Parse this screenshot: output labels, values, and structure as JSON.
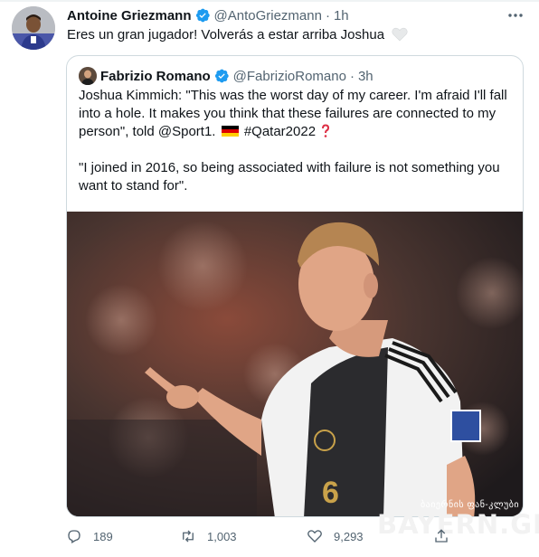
{
  "tweet": {
    "author_name": "Antoine Griezmann",
    "author_handle": "@AntoGriezmann",
    "separator": "·",
    "time": "1h",
    "text": "Eres un gran jugador! Volverás a estar arriba Joshua",
    "heart_icon": "white-heart-emoji"
  },
  "quote": {
    "author_name": "Fabrizio Romano",
    "author_handle": "@FabrizioRomano",
    "separator": "·",
    "time": "3h",
    "lines": [
      "Joshua Kimmich: \"This was the worst day of my career. I'm afraid I'll fall",
      "into a hole. It makes you think that these failures are connected to my",
      "person\", told @Sport1."
    ],
    "hashtag": "#Qatar2022",
    "lines2": [
      "\"I joined in 2016, so being associated with failure is not something you",
      "want to stand for\"."
    ],
    "flag_icon": "germany-flag-emoji",
    "question_icon": "red-question-mark-emoji"
  },
  "actions": {
    "replies": "189",
    "retweets": "1,003",
    "likes": "9,293"
  },
  "watermark": {
    "small": "ბაიერნის ფან-კლუბი",
    "big": "BAYERN.GE"
  },
  "colors": {
    "verified": "#1d9bf0",
    "secondary_text": "#536471",
    "border": "#cfd9de"
  }
}
